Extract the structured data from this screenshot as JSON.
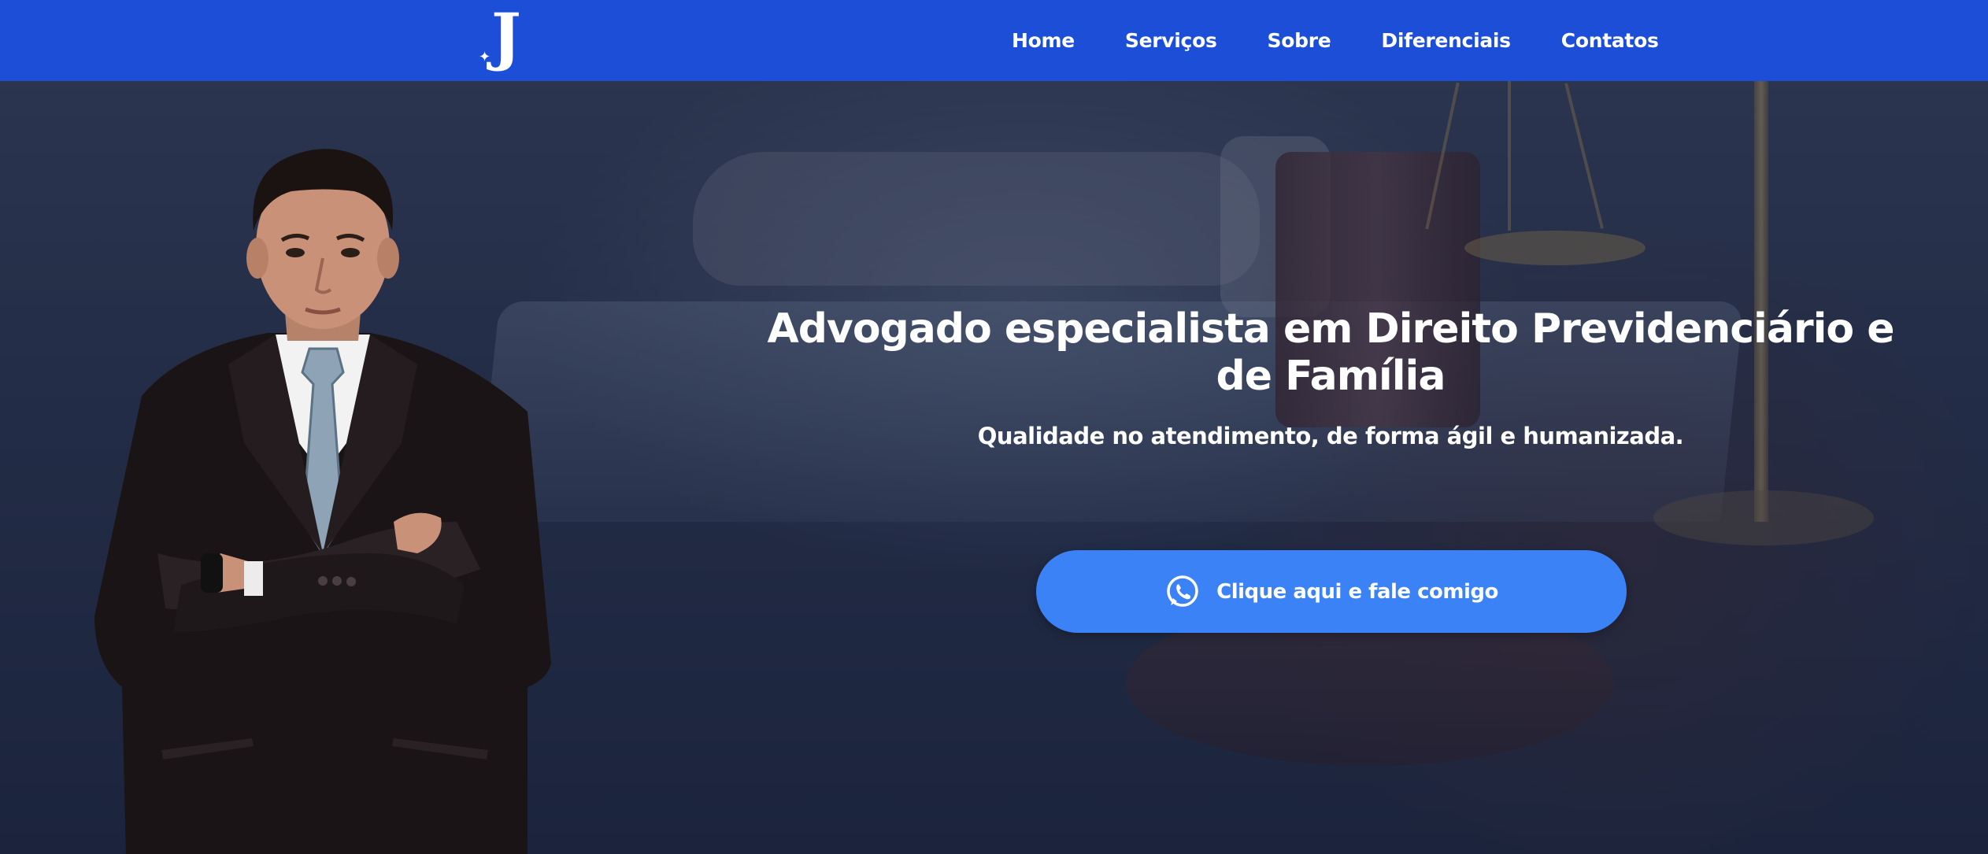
{
  "header": {
    "logo_letter": "J",
    "logo_mark": "✦",
    "nav": [
      {
        "label": "Home"
      },
      {
        "label": "Serviços"
      },
      {
        "label": "Sobre"
      },
      {
        "label": "Diferenciais"
      },
      {
        "label": "Contatos"
      }
    ]
  },
  "hero": {
    "title": "Advogado especialista em Direito Previdenciário e de Família",
    "subtitle": "Qualidade no atendimento, de forma ágil e humanizada.",
    "cta_label": "Clique aqui e fale comigo",
    "cta_icon": "whatsapp-icon"
  },
  "colors": {
    "navbar": "#1d4ed8",
    "cta": "#3b82f6",
    "text": "#ffffff"
  }
}
